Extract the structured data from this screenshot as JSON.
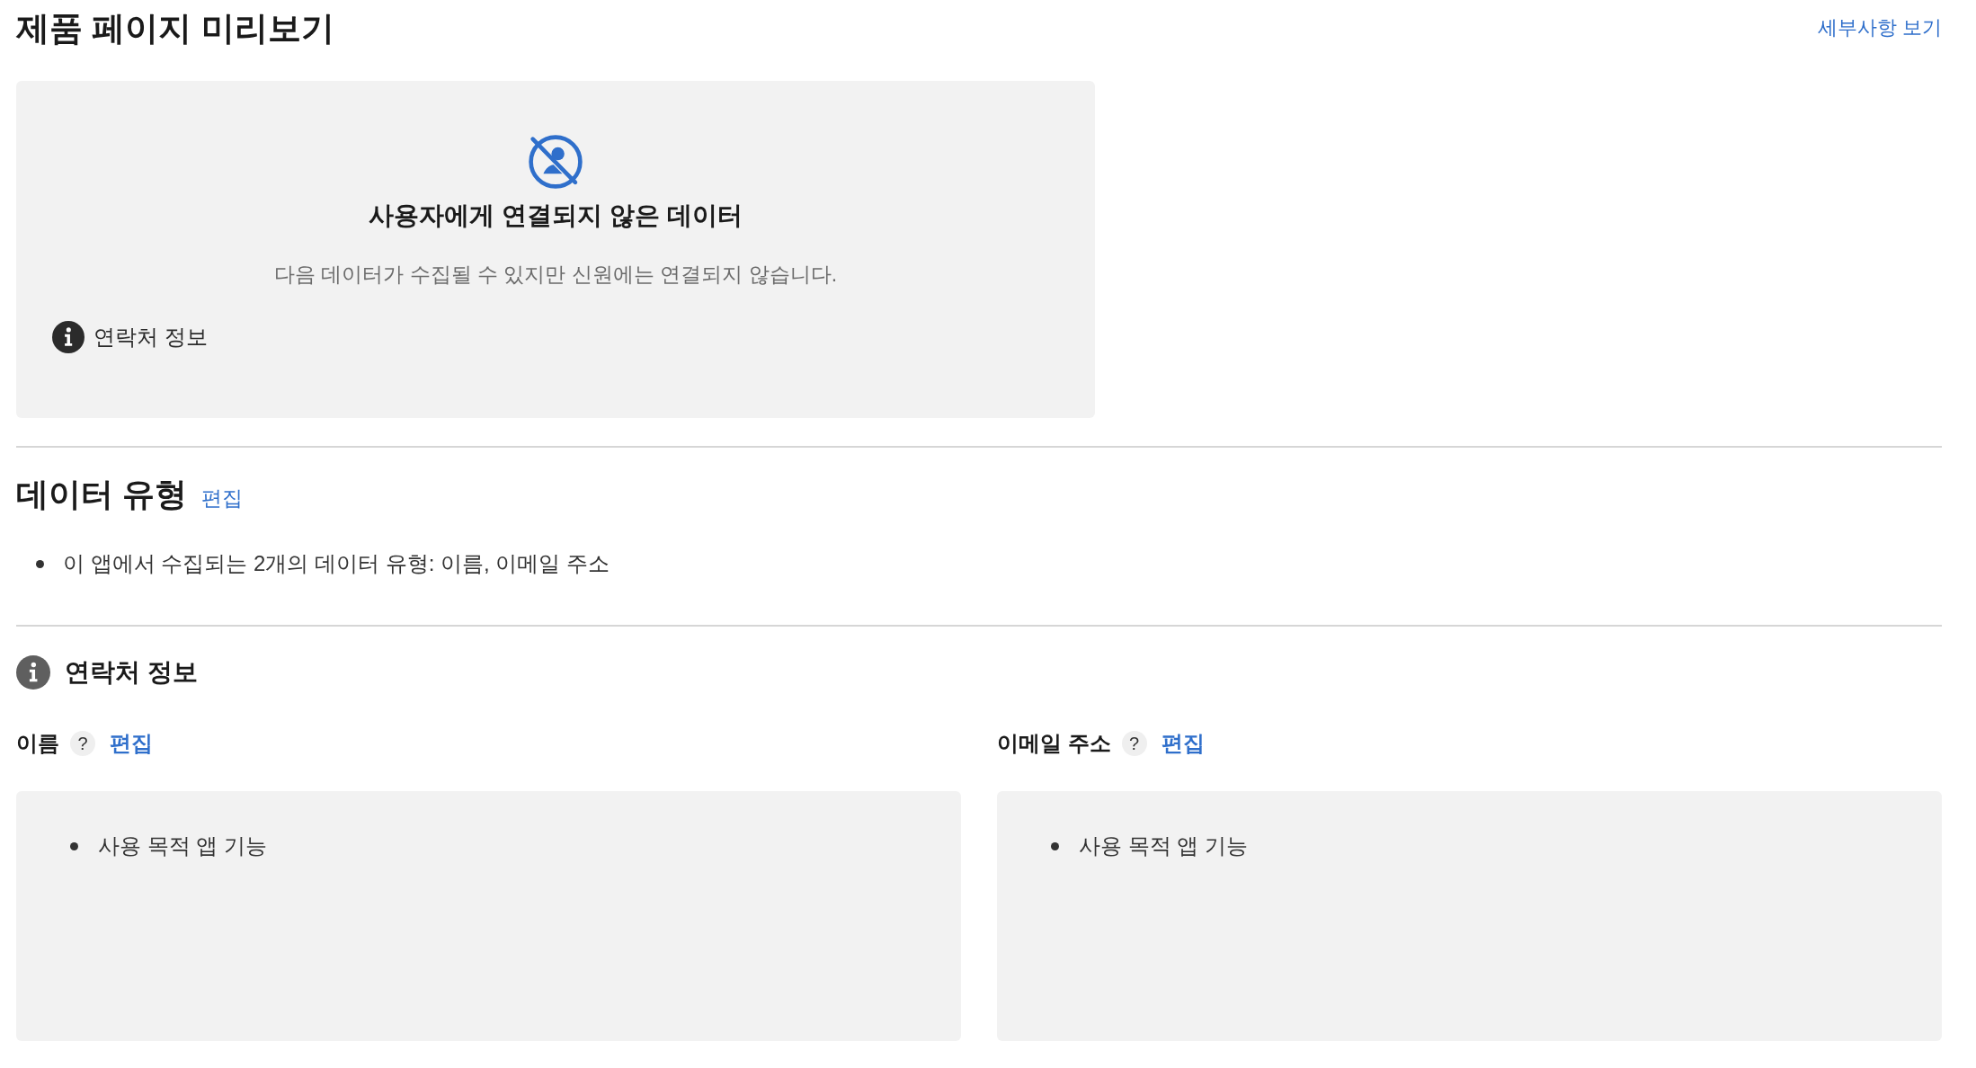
{
  "header": {
    "title": "제품 페이지 미리보기",
    "details_link": "세부사항 보기"
  },
  "preview_card": {
    "heading": "사용자에게 연결되지 않은 데이터",
    "description": "다음 데이터가 수집될 수 있지만 신원에는 연결되지 않습니다.",
    "categories": [
      "연락처 정보"
    ]
  },
  "data_types": {
    "heading": "데이터 유형",
    "edit_link": "편집",
    "items": [
      "이 앱에서 수집되는 2개의 데이터 유형: 이름, 이메일 주소"
    ]
  },
  "category": {
    "heading": "연락처 정보",
    "fields": [
      {
        "label": "이름",
        "help": "?",
        "edit_link": "편집",
        "purposes": [
          "사용 목적 앱 기능"
        ]
      },
      {
        "label": "이메일 주소",
        "help": "?",
        "edit_link": "편집",
        "purposes": [
          "사용 목적 앱 기능"
        ]
      }
    ]
  }
}
